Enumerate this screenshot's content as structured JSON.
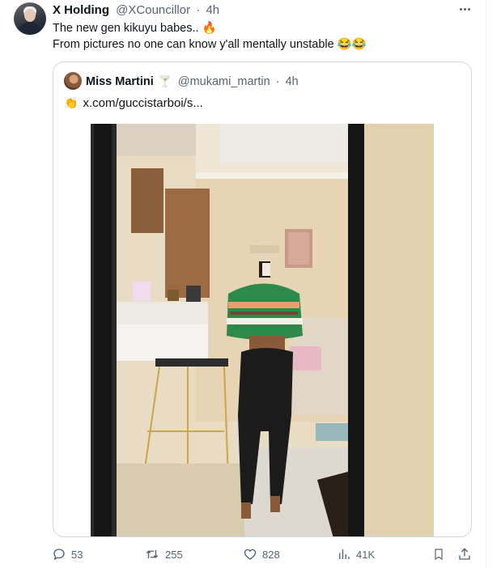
{
  "tweet": {
    "author_name": "X Holding",
    "handle": "@XCouncillor",
    "separator": "·",
    "time": "4h",
    "text_line1": "The new gen kikuyu babes.. 🔥",
    "text_line2": "From pictures no one can know y'all mentally unstable 😂😂"
  },
  "quote": {
    "author_name": "Miss Martini",
    "badge_emoji": "🍸",
    "handle": "@mukami_martin",
    "separator": "·",
    "time": "4h",
    "clap_emoji": "👏",
    "link_text": "x.com/guccistarboi/s..."
  },
  "actions": {
    "replies": "53",
    "reposts": "255",
    "likes": "828",
    "views": "41K"
  },
  "icons": [
    "more-icon",
    "reply-icon",
    "repost-icon",
    "like-icon",
    "views-icon",
    "bookmark-icon",
    "share-icon"
  ],
  "colors": {
    "text_primary": "#0f1419",
    "text_secondary": "#536471",
    "border": "#cfd9de"
  }
}
